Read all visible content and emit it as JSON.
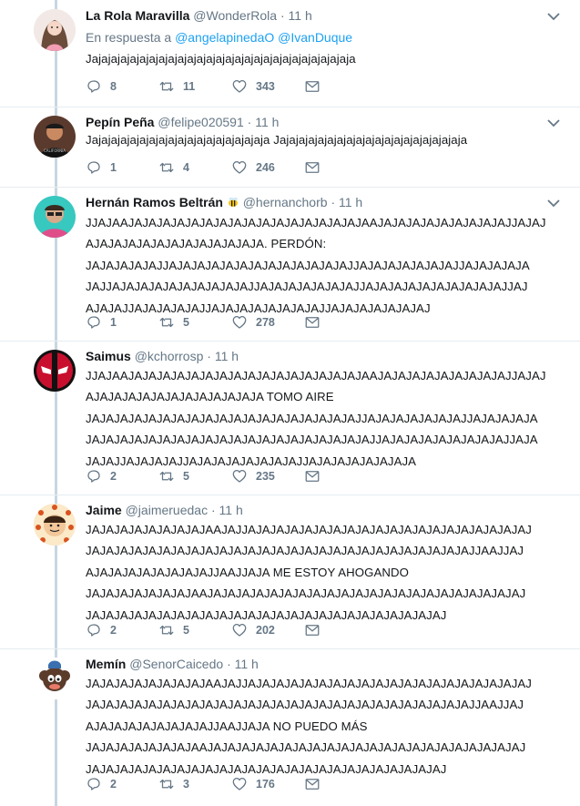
{
  "tweets": [
    {
      "name": "La Rola Maravilla",
      "handle": "@WonderRola",
      "time": "11 h",
      "reply_prefix": "En respuesta a",
      "mentions": [
        "@angelapinedaO",
        "@IvanDuque"
      ],
      "text": "Jajajajajajajajajajajajajajajajajajajajajajajajajajajaja",
      "replies": "8",
      "retweets": "11",
      "likes": "343"
    },
    {
      "name": "Pepín Peña",
      "handle": "@felipe020591",
      "time": "11 h",
      "text": "Jajajajajajajajajajajajajajajajajajaja Jajajajajajajajajajajajajajajajajajajaja",
      "replies": "1",
      "retweets": "4",
      "likes": "246"
    },
    {
      "name": "Hernán Ramos Beltrán",
      "name_emoji": "bee-icon",
      "handle": "@hernanchorb",
      "time": "11 h",
      "text": "JJAJAAJAJAJAJAJAJAJAJAJAJAJAJAJAJAJAJAJAAJAJAJAJAJAJAJAJAJAJJAJAJ\nAJAJAJAJAJAJAJAJAJAJAJAJA. PERDÓN:\nJAJAJAJAJAJJAJAJAJAJAJAJAJAJAJAJAJAJAJJAJAJAJAJAJAJAJJAJAJAJAJA\nJAJJAJAJAJAJAJAJAJAJAJAJJAJAJAJAJAJAJAJJAJAJAJAJAJAJAJAJAJAJJAJ\nAJAJAJJAJAJAJAJAJJAJAJAJAJAJAJAJAJJAJAJAJAJAJAJAJ",
      "replies": "1",
      "retweets": "5",
      "likes": "278"
    },
    {
      "name": "Saimus",
      "handle": "@kchorrosp",
      "time": "11 h",
      "text": "JJAJAAJAJAJAJAJAJAJAJAJAJAJAJAJAJAJAJAJAAJAJAJAJAJAJAJAJAJAJJAJAJ\nAJAJAJAJAJAJAJAJAJAJAJAJA TOMO AIRE\nJAJAJAJAJAJAJAJAJAJAJAJAJAJAJAJAJAJAJAJJAJAJAJAJAJAJAJJAJAJAJAJA\nJAJAJAJAJAJAJAJAJAJAJAJAJAJAJAJAJAJAJAJAJJAJAJAJAJAJAJAJAJAJJAJA\nJAJAJJAJAJAJAJJAJAJAJAJAJAJAJAJJAJAJAJAJAJAJAJA",
      "replies": "2",
      "retweets": "5",
      "likes": "235"
    },
    {
      "name": "Jaime",
      "handle": "@jaimeruedac",
      "time": "11 h",
      "text": "JAJAJAJAJAJAJAJAJAAJAJJAJAJAJAJAJAJAJAJAJAJAJAJAJAJAJAJAJAJAJAJ\nJAJAJAJAJAJAJAJAJAJAJAJAJAJAJAJAJAJAJAJAJAJAJAJAJAJAJAJJAAJJAJ\nAJAJAJAJAJAJAJAJAJJAAJJAJA ME ESTOY AHOGANDO\nJAJAJAJAJAJAJAJAAJAJAJAJAJAJAJAJAJAJAJAJAJAJAJAJAJAJAJAJAJAJAJ\nJAJAJAJAJAJAJAJAJAJAJAJAJAJAJAJAJAJAJAJAJAJAJAJAJAJ",
      "replies": "2",
      "retweets": "5",
      "likes": "202"
    },
    {
      "name": "Memín",
      "handle": "@SenorCaicedo",
      "time": "11 h",
      "text": "JAJAJAJAJAJAJAJAJAAJAJJAJAJAJAJAJAJAJAJAJAJAJAJAJAJAJAJAJAJAJAJ\nJAJAJAJAJAJAJAJAJAJAJAJAJAJAJAJAJAJAJAJAJAJAJAJAJAJAJAJJAAJJAJ\nAJAJAJAJAJAJAJAJAJJAAJJAJA NO PUEDO MÁS\nJAJAJAJAJAJAJAJAAJAJAJAJAJAJAJAJAJAJAJAJAJAJAJAJAJAJAJAJAJAJAJ\nJAJAJAJAJAJAJAJAJAJAJAJAJAJAJAJAJAJAJAJAJAJAJAJAJAJ",
      "replies": "2",
      "retweets": "3",
      "likes": "176"
    }
  ],
  "separator": "·",
  "icons": {
    "reply": "reply-icon",
    "retweet": "retweet-icon",
    "like": "heart-icon",
    "dm": "envelope-icon",
    "more": "chevron-down-icon"
  },
  "colors": {
    "accent": "#1da1f2",
    "muted": "#657786",
    "thread_line": "#c8d7e1",
    "divider": "#e6ecf0"
  }
}
